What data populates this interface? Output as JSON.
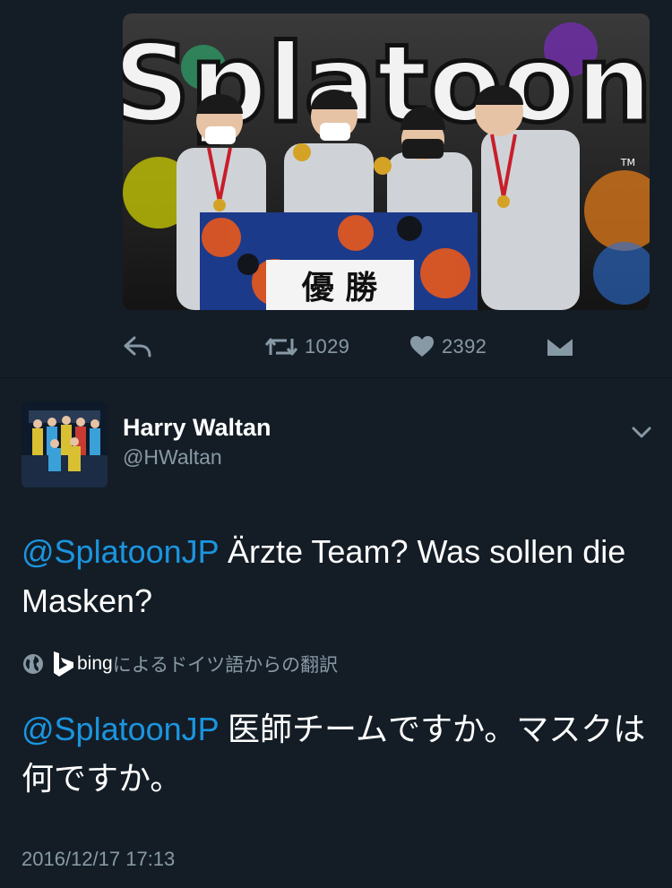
{
  "photo": {
    "banner_text": "Splatoon",
    "trademark": "TM",
    "trophy_text": "優 勝"
  },
  "actions": {
    "retweet_count": "1029",
    "like_count": "2392"
  },
  "reply": {
    "display_name": "Harry Waltan",
    "handle": "@HWaltan",
    "text_mention": "@SplatoonJP",
    "text_body": " Ärzte Team? Was sollen die Masken?",
    "translation_provider": "bing",
    "translation_note": "によるドイツ語からの翻訳",
    "translated_mention": "@SplatoonJP",
    "translated_body": " 医師チームですか。マスクは何ですか。",
    "timestamp": "2016/12/17 17:13"
  },
  "colors": {
    "background": "#141d26",
    "mention": "#1b95e0",
    "muted": "#8899a6"
  },
  "icons": {
    "reply": "reply-arrow-icon",
    "retweet": "retweet-icon",
    "like": "heart-icon",
    "dm": "envelope-icon",
    "globe": "globe-icon",
    "bing": "bing-logo-icon",
    "chevron": "chevron-down-icon"
  }
}
